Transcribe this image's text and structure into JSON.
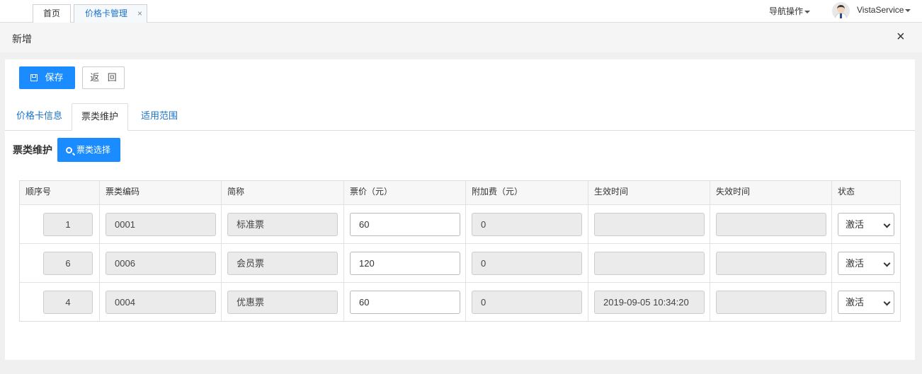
{
  "topbar": {
    "tabs": [
      {
        "label": "首页"
      },
      {
        "label": "价格卡管理",
        "close": "×"
      }
    ],
    "nav_ops": "导航操作",
    "user": "VistaService"
  },
  "dialog": {
    "title": "新增",
    "close": "×"
  },
  "toolbar": {
    "save": "保存",
    "back": "返 回"
  },
  "panel_tabs": [
    "价格卡信息",
    "票类维护",
    "适用范围"
  ],
  "section": {
    "title": "票类维护",
    "select_button": "票类选择"
  },
  "table": {
    "headers": [
      "顺序号",
      "票类编码",
      "简称",
      "票价（元）",
      "附加费（元）",
      "生效时间",
      "失效时间",
      "状态"
    ],
    "rows": [
      {
        "seq": "1",
        "code": "0001",
        "name": "标准票",
        "price": "60",
        "surcharge": "0",
        "effective": "",
        "expire": "",
        "status": "激活"
      },
      {
        "seq": "6",
        "code": "0006",
        "name": "会员票",
        "price": "120",
        "surcharge": "0",
        "effective": "",
        "expire": "",
        "status": "激活"
      },
      {
        "seq": "4",
        "code": "0004",
        "name": "优惠票",
        "price": "60",
        "surcharge": "0",
        "effective": "2019-09-05 10:34:20",
        "expire": "",
        "status": "激活"
      }
    ]
  },
  "colors": {
    "primary": "#1a8cff",
    "link": "#1a73c8",
    "disabled_input": "#ebebeb"
  }
}
